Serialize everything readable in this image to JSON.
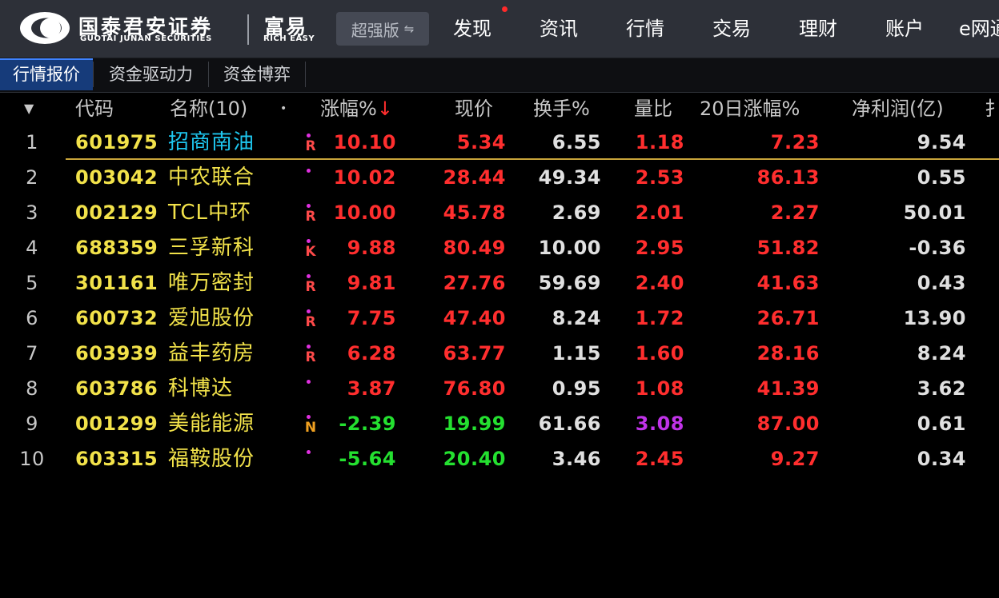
{
  "header": {
    "brand_cn": "国泰君安证券",
    "brand_en": "GUOTAI JUNAN SECURITIES",
    "product_cn": "富易",
    "product_en": "RICH EASY",
    "edition": "超强版",
    "nav": [
      "发现",
      "资讯",
      "行情",
      "交易",
      "理财",
      "账户",
      "e网通"
    ]
  },
  "tabs": [
    "行情报价",
    "资金驱动力",
    "资金博弈"
  ],
  "columns": {
    "code": "代码",
    "name": "名称(10)",
    "change": "涨幅%",
    "change_sort_arrow": "↓",
    "price": "现价",
    "turnover": "换手%",
    "volume_ratio": "量比",
    "change_20d": "20日涨幅%",
    "net_profit": "净利润(亿)",
    "cut_off": "扌"
  },
  "rows": [
    {
      "idx": "1",
      "code": "601975",
      "name": "招商南油",
      "flag": "R",
      "change": "10.10",
      "price": "5.34",
      "turnover": "6.55",
      "vol_ratio": "1.18",
      "chg20": "7.23",
      "net_profit": "9.54"
    },
    {
      "idx": "2",
      "code": "003042",
      "name": "中农联合",
      "flag": "",
      "change": "10.02",
      "price": "28.44",
      "turnover": "49.34",
      "vol_ratio": "2.53",
      "chg20": "86.13",
      "net_profit": "0.55"
    },
    {
      "idx": "3",
      "code": "002129",
      "name": "TCL中环",
      "flag": "R",
      "change": "10.00",
      "price": "45.78",
      "turnover": "2.69",
      "vol_ratio": "2.01",
      "chg20": "2.27",
      "net_profit": "50.01"
    },
    {
      "idx": "4",
      "code": "688359",
      "name": "三孚新科",
      "flag": "K",
      "change": "9.88",
      "price": "80.49",
      "turnover": "10.00",
      "vol_ratio": "2.95",
      "chg20": "51.82",
      "net_profit": "-0.36"
    },
    {
      "idx": "5",
      "code": "301161",
      "name": "唯万密封",
      "flag": "R",
      "change": "9.81",
      "price": "27.76",
      "turnover": "59.69",
      "vol_ratio": "2.40",
      "chg20": "41.63",
      "net_profit": "0.43"
    },
    {
      "idx": "6",
      "code": "600732",
      "name": "爱旭股份",
      "flag": "R",
      "change": "7.75",
      "price": "47.40",
      "turnover": "8.24",
      "vol_ratio": "1.72",
      "chg20": "26.71",
      "net_profit": "13.90"
    },
    {
      "idx": "7",
      "code": "603939",
      "name": "益丰药房",
      "flag": "R",
      "change": "6.28",
      "price": "63.77",
      "turnover": "1.15",
      "vol_ratio": "1.60",
      "chg20": "28.16",
      "net_profit": "8.24"
    },
    {
      "idx": "8",
      "code": "603786",
      "name": "科博达",
      "flag": "",
      "change": "3.87",
      "price": "76.80",
      "turnover": "0.95",
      "vol_ratio": "1.08",
      "chg20": "41.39",
      "net_profit": "3.62"
    },
    {
      "idx": "9",
      "code": "001299",
      "name": "美能能源",
      "flag": "N",
      "change": "-2.39",
      "price": "19.99",
      "turnover": "61.66",
      "vol_ratio": "3.08",
      "chg20": "87.00",
      "net_profit": "0.61"
    },
    {
      "idx": "10",
      "code": "603315",
      "name": "福鞍股份",
      "flag": "",
      "change": "-5.64",
      "price": "20.40",
      "turnover": "3.46",
      "vol_ratio": "2.45",
      "chg20": "9.27",
      "net_profit": "0.34"
    }
  ]
}
